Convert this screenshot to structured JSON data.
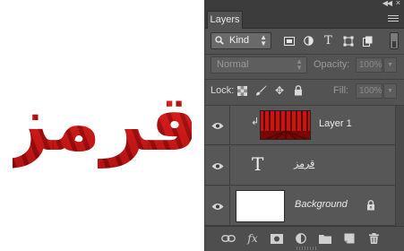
{
  "canvas": {
    "text": "قرمز",
    "colors": {
      "light": "#e02020",
      "dark": "#8e0a0a"
    }
  },
  "panel": {
    "tab_label": "Layers",
    "filter": {
      "kind_label": "Kind"
    },
    "blend": {
      "mode": "Normal",
      "opacity_label": "Opacity:",
      "opacity_value": "100%"
    },
    "lock": {
      "label": "Lock:",
      "fill_label": "Fill:",
      "fill_value": "100%"
    },
    "layers": [
      {
        "name": "Layer 1",
        "type": "image",
        "visible": true,
        "clipped": true
      },
      {
        "name": "قرمز",
        "type": "text",
        "visible": true
      },
      {
        "name": "Background",
        "type": "background",
        "visible": true,
        "locked": true
      }
    ],
    "bottom_icons": [
      "link-icon",
      "fx-icon",
      "mask-icon",
      "adjustment-icon",
      "folder-icon",
      "new-layer-icon",
      "trash-icon"
    ]
  },
  "colors": {
    "panel_bg": "#535353",
    "accent_red": "#d81818"
  }
}
